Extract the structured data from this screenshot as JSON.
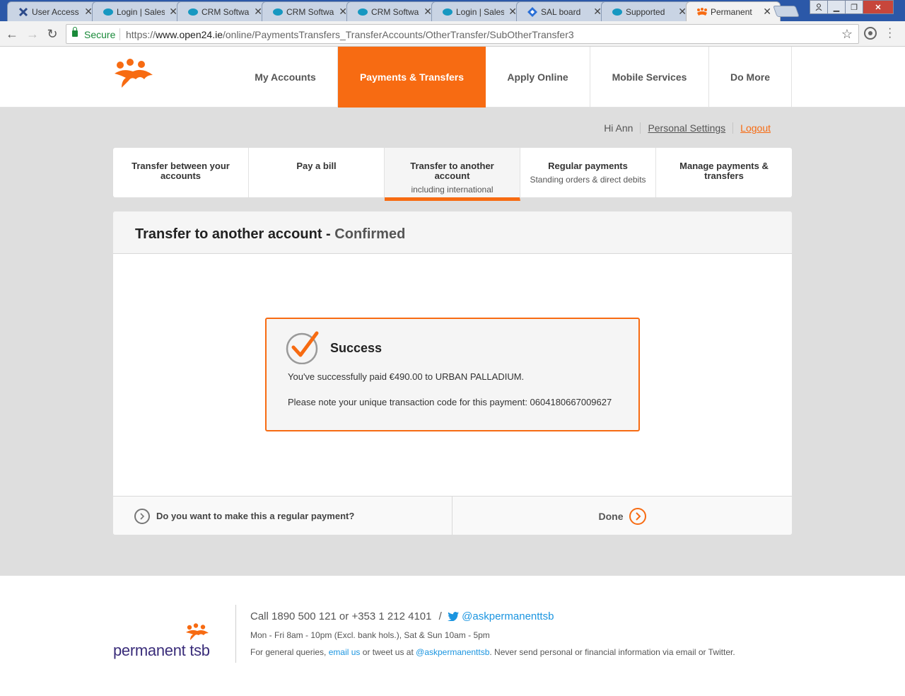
{
  "browser": {
    "tabs": [
      {
        "title": "User Access",
        "icon": "jira-x-icon"
      },
      {
        "title": "Login | Salesforce",
        "icon": "salesforce-cloud-icon"
      },
      {
        "title": "CRM Software",
        "icon": "salesforce-cloud-icon"
      },
      {
        "title": "CRM Software",
        "icon": "salesforce-cloud-icon"
      },
      {
        "title": "CRM Software",
        "icon": "salesforce-cloud-icon"
      },
      {
        "title": "Login | Salesforce",
        "icon": "salesforce-cloud-icon"
      },
      {
        "title": "SAL board",
        "icon": "jira-diamond-icon"
      },
      {
        "title": "Supported",
        "icon": "salesforce-cloud-icon"
      },
      {
        "title": "Permanent",
        "icon": "ptsb-people-icon",
        "active": true
      }
    ],
    "address": {
      "secure_label": "Secure",
      "scheme": "https://",
      "host": "www.open24.ie",
      "path": "/online/PaymentsTransfers_TransferAccounts/OtherTransfer/SubOtherTransfer3"
    }
  },
  "header": {
    "nav": [
      {
        "label": "My Accounts",
        "active": false
      },
      {
        "label": "Payments & Transfers",
        "active": true
      },
      {
        "label": "Apply Online",
        "active": false
      },
      {
        "label": "Mobile Services",
        "active": false
      },
      {
        "label": "Do More",
        "active": false
      }
    ]
  },
  "user_menu": {
    "greeting": "Hi Ann",
    "settings": "Personal Settings",
    "logout": "Logout"
  },
  "sub_tabs": [
    {
      "label": "Transfer between your accounts",
      "sub": "",
      "active": false
    },
    {
      "label": "Pay a bill",
      "sub": "",
      "active": false
    },
    {
      "label": "Transfer to another account",
      "sub": "including international",
      "active": true
    },
    {
      "label": "Regular payments",
      "sub": "Standing orders & direct debits",
      "active": false
    },
    {
      "label": "Manage payments & transfers",
      "sub": "",
      "active": false
    }
  ],
  "panel": {
    "title": "Transfer to another account -",
    "status": "Confirmed",
    "success": {
      "title": "Success",
      "message": "You've successfully paid €490.00 to URBAN PALLADIUM.",
      "code_text": "Please note your unique transaction code for this payment: 0604180667009627"
    },
    "footer": {
      "regular_prompt": "Do you want to make this a regular payment?",
      "done": "Done"
    }
  },
  "footer": {
    "brand": "permanent tsb",
    "phone_text": "Call 1890 500 121 or +353 1 212 4101",
    "slash": "/",
    "twitter_handle": "@askpermanenttsb",
    "hours": "Mon - Fri 8am - 10pm (Excl. bank hols.), Sat & Sun 10am - 5pm",
    "queries_prefix": "For general queries,",
    "email_link": "email us",
    "queries_mid": "or tweet us at",
    "queries_twitter": "@askpermanenttsb",
    "queries_suffix": ". Never send personal or financial information via email or Twitter."
  },
  "colors": {
    "brand_orange": "#f76b12",
    "brand_purple": "#3a2d7a",
    "link_blue": "#1b95e0"
  }
}
